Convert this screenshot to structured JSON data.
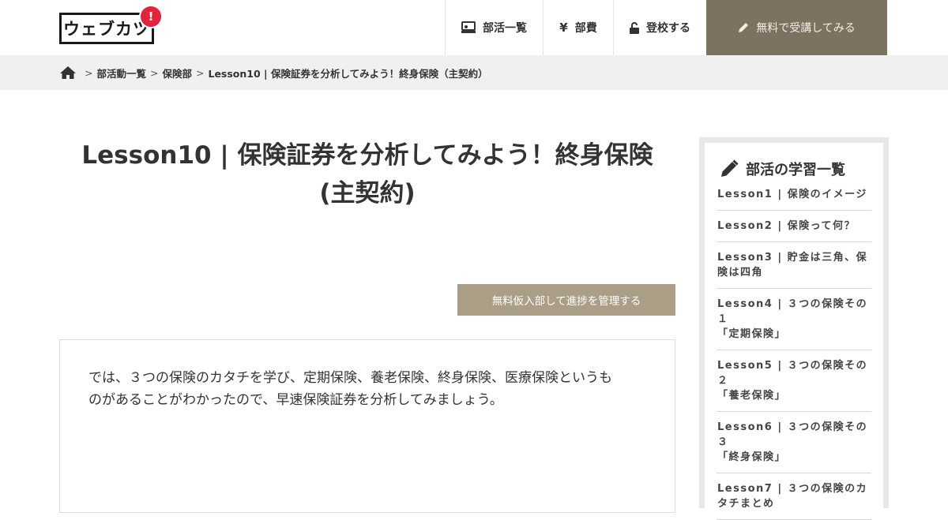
{
  "header": {
    "logo_text": "ウェブカツ",
    "logo_badge": "!",
    "nav": [
      {
        "label": "部活一覧",
        "icon": "laptop-person-icon"
      },
      {
        "label": "部費",
        "icon": "yen-icon"
      },
      {
        "label": "登校する",
        "icon": "unlock-icon"
      },
      {
        "label": "無料で受講してみる",
        "icon": "pencil-icon"
      }
    ]
  },
  "breadcrumb": {
    "sep": ">",
    "items": [
      "部活動一覧",
      "保険部",
      "Lesson10 | 保険証券を分析してみよう！終身保険（主契約）"
    ]
  },
  "main": {
    "title_line1": "Lesson10 | 保険証券を分析してみよう！終身保険",
    "title_line2": "(主契約)",
    "manage_button": "無料仮入部して進捗を管理する",
    "body_line1": "では、３つの保険のカタチを学び、定期保険、養老保険、終身保険、医療保険というも",
    "body_line2": "のがあることがわかったので、早速保険証券を分析してみましょう。"
  },
  "sidebar": {
    "title": "部活の学習一覧",
    "lessons": [
      "Lesson1 | 保険のイメージ",
      "Lesson2 | 保険って何？",
      "Lesson3 | 貯金は三角、保険は四角",
      "Lesson4 | ３つの保険その１\n「定期保険」",
      "Lesson5 | ３つの保険その２\n「養老保険」",
      "Lesson6 | ３つの保険その３\n「終身保険」",
      "Lesson7 | ３つの保険のカタチまとめ"
    ]
  },
  "colors": {
    "cta_bg": "#7d7160",
    "manage_bg": "#ab9e86",
    "badge": "#e2243a",
    "crumb_bg": "#f0f0f0"
  }
}
